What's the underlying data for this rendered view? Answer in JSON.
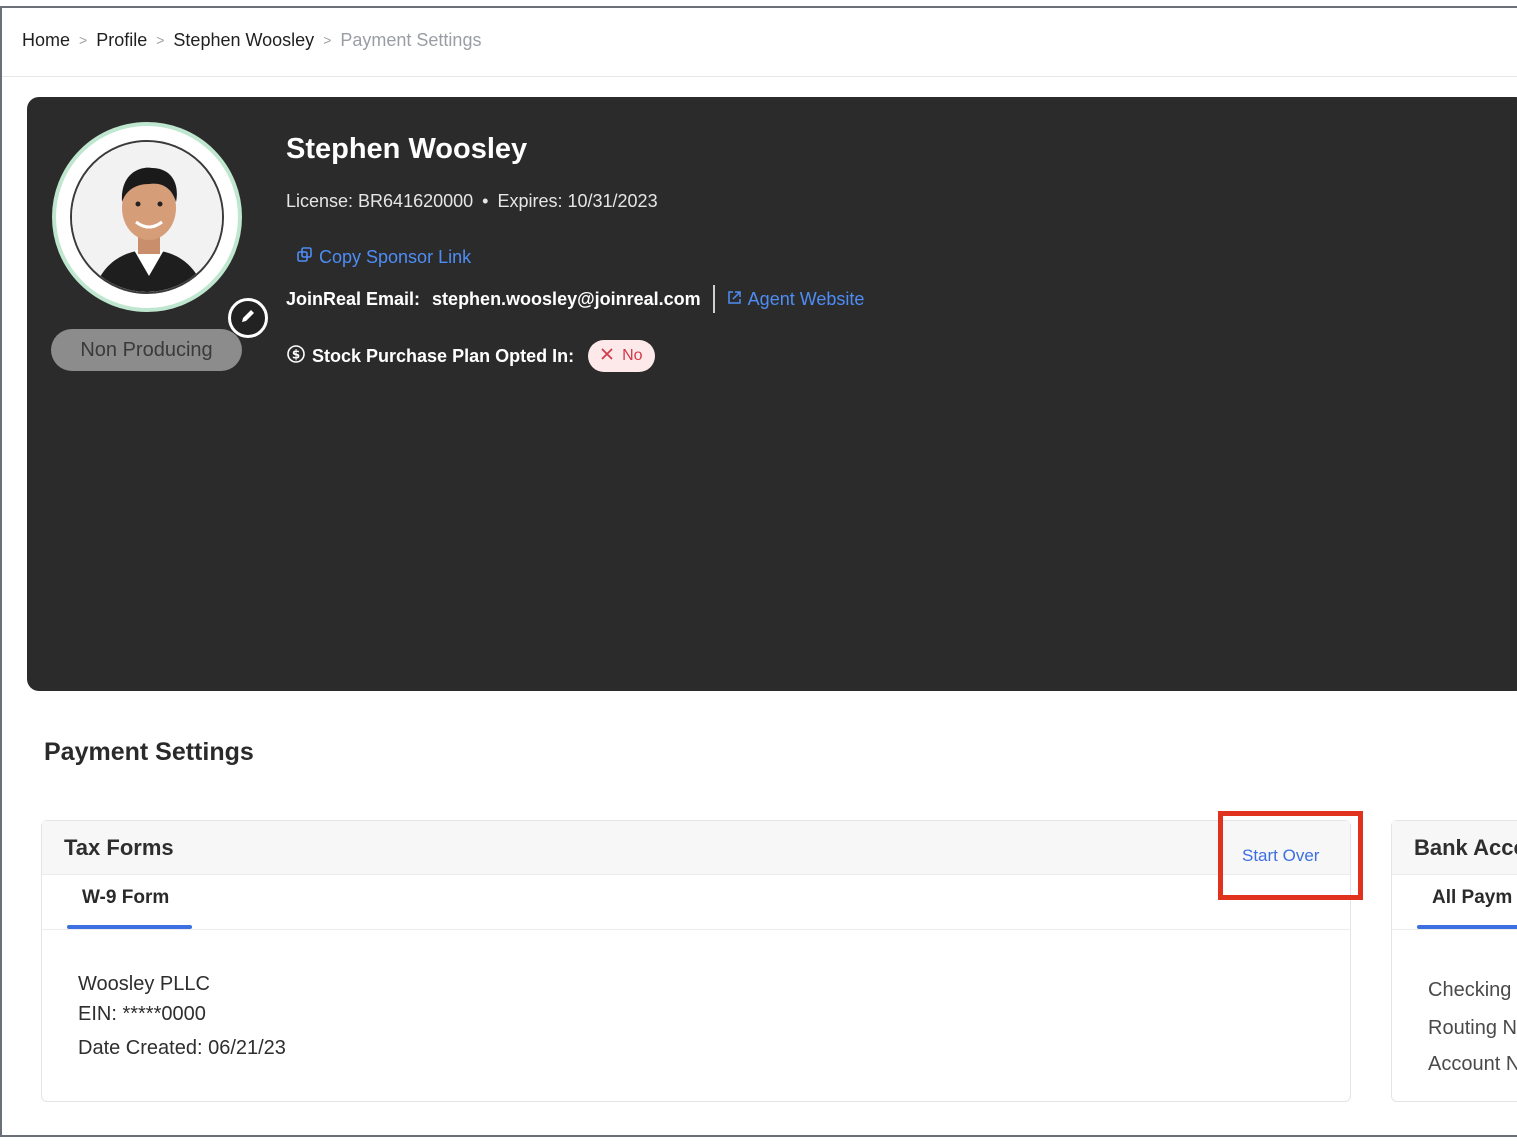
{
  "breadcrumb": {
    "items": [
      "Home",
      "Profile",
      "Stephen Woosley"
    ],
    "current": "Payment Settings",
    "separator": ">"
  },
  "profile": {
    "name": "Stephen Woosley",
    "license_label": "License: BR641620000",
    "license_sep": "•",
    "expires_label": "Expires: 10/31/2023",
    "sponsor_link": "Copy Sponsor Link",
    "email_label": "JoinReal Email:",
    "email": "stephen.woosley@joinreal.com",
    "agent_website": "Agent Website",
    "stock_label": "Stock Purchase Plan Opted In:",
    "stock_value": "No",
    "status": "Non Producing"
  },
  "payment": {
    "title": "Payment Settings",
    "tax_forms": {
      "title": "Tax Forms",
      "action": "Start Over",
      "tab": "W-9 Form",
      "company": "Woosley PLLC",
      "ein": "EIN: *****0000",
      "date_label": "Date Created:",
      "date_value": "06/21/23"
    },
    "bank": {
      "title": "Bank Acco",
      "tab": "All Paym",
      "line1": "Checking",
      "line2": "Routing N",
      "line3": "Account N"
    }
  },
  "colors": {
    "hero_bg": "#2b2b2b",
    "link": "#4e8df5",
    "accent": "#3d6fe0",
    "highlight": "#e0321e",
    "no_pill_bg": "#fde8ea",
    "no_pill_text": "#d33a4a"
  }
}
